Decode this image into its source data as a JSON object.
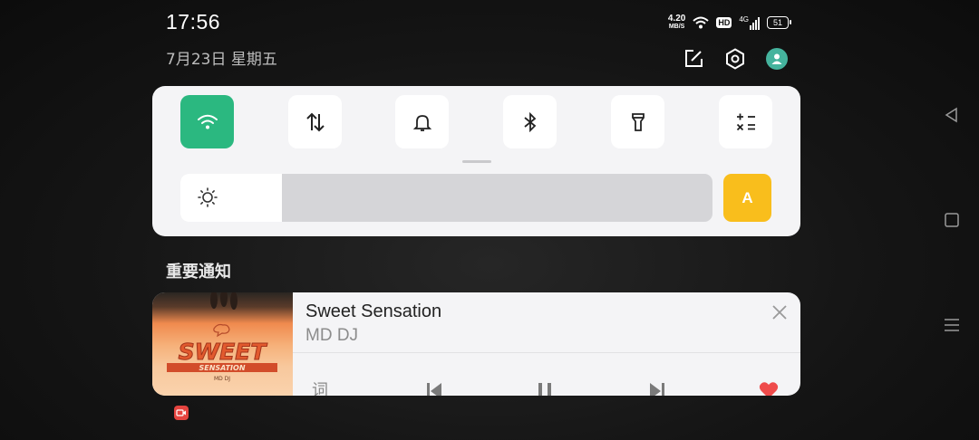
{
  "status_bar": {
    "time": "17:56",
    "date": "7月23日  星期五",
    "net_speed_value": "4.20",
    "net_speed_unit": "MB/S",
    "hd_label": "HD",
    "signal_label": "4G",
    "battery": "51",
    "icons": [
      "wifi-icon",
      "hd-icon",
      "signal-icon",
      "battery-icon"
    ]
  },
  "header_actions": [
    "edit-icon",
    "settings-icon",
    "user-avatar-icon"
  ],
  "quick_settings": {
    "tiles": [
      {
        "name": "wifi",
        "icon": "wifi-icon",
        "active": true
      },
      {
        "name": "mobile-data",
        "icon": "data-arrows-icon",
        "active": false
      },
      {
        "name": "ring",
        "icon": "bell-icon",
        "active": false
      },
      {
        "name": "bluetooth",
        "icon": "bluetooth-icon",
        "active": false
      },
      {
        "name": "flashlight",
        "icon": "flashlight-icon",
        "active": false
      },
      {
        "name": "calculator",
        "icon": "calculator-icon",
        "active": false
      }
    ],
    "brightness_level": 0.19,
    "auto_brightness_label": "A"
  },
  "notifications": {
    "section_title": "重要通知",
    "media": {
      "song_title": "Sweet Sensation",
      "artist": "MD DJ",
      "art_title": "SWEET",
      "art_subtitle": "SENSATION",
      "art_caption": "MD DJ",
      "lyrics_label": "词",
      "liked": true
    }
  },
  "colors": {
    "accent_green": "#2bb880",
    "auto_yellow": "#f9be1c",
    "like_red": "#ef4b4b",
    "avatar_teal": "#45b39d"
  }
}
